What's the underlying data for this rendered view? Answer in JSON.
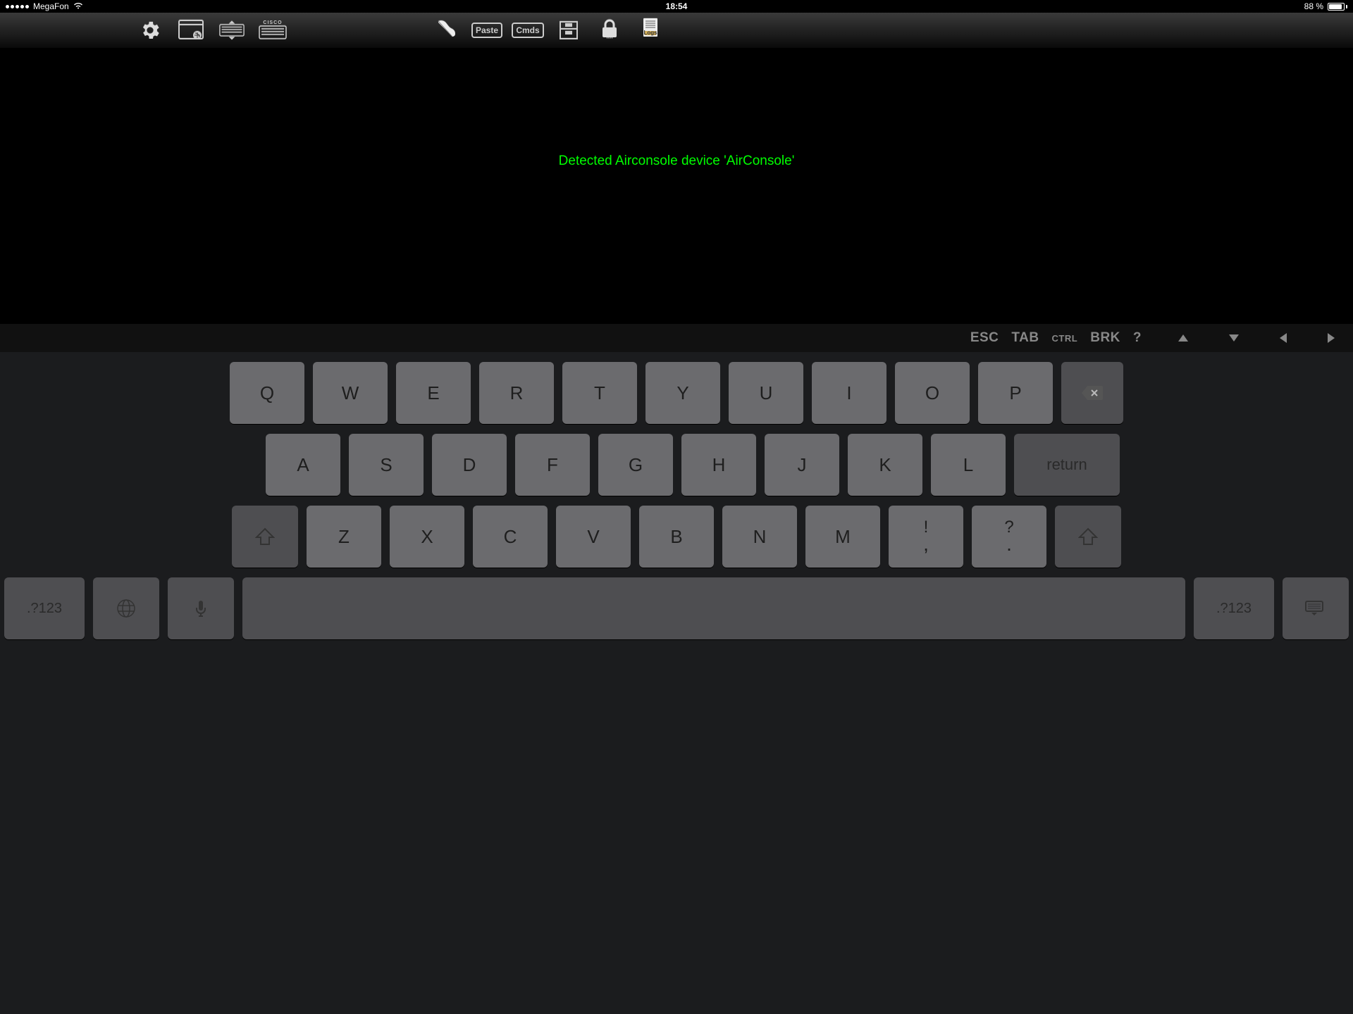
{
  "status": {
    "carrier": "MegaFon",
    "time": "18:54",
    "battery_text": "88 %",
    "battery_pct": 88
  },
  "toolbar": {
    "icons_left": [
      {
        "name": "settings-gear-icon"
      },
      {
        "name": "browser-window-icon"
      },
      {
        "name": "keyboard-icon"
      },
      {
        "name": "cisco-keyboard-icon",
        "label": "CISCO"
      }
    ],
    "icons_right": [
      {
        "name": "script-scroll-icon"
      },
      {
        "name": "paste-button",
        "label": "Paste"
      },
      {
        "name": "cmds-button",
        "label": "Cmds"
      },
      {
        "name": "file-drawer-icon"
      },
      {
        "name": "lock-password-icon"
      },
      {
        "name": "logs-button",
        "label": "Logs"
      }
    ]
  },
  "terminal": {
    "message": "Detected Airconsole device 'AirConsole'"
  },
  "side_tab": {
    "name": "attachment-clip"
  },
  "fnrow": {
    "keys": [
      {
        "label": "ESC"
      },
      {
        "label": "TAB"
      },
      {
        "label": "CTRL",
        "small": true
      },
      {
        "label": "BRK"
      },
      {
        "label": "?"
      }
    ],
    "arrows": [
      "up",
      "down",
      "left",
      "right"
    ]
  },
  "keyboard": {
    "row1": [
      "Q",
      "W",
      "E",
      "R",
      "T",
      "Y",
      "U",
      "I",
      "O",
      "P"
    ],
    "row2": [
      "A",
      "S",
      "D",
      "F",
      "G",
      "H",
      "J",
      "K",
      "L"
    ],
    "row2_return": "return",
    "row3": [
      "Z",
      "X",
      "C",
      "V",
      "B",
      "N",
      "M"
    ],
    "row3_punct": [
      {
        "top": "!",
        "bot": ","
      },
      {
        "top": "?",
        "bot": "."
      }
    ],
    "row4_numkey": ".?123"
  }
}
